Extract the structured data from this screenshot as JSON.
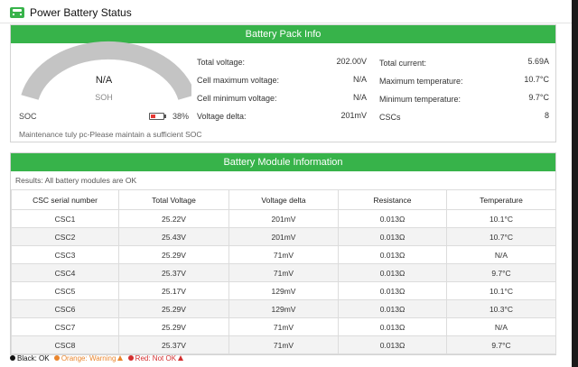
{
  "window": {
    "title": "Power Battery Status",
    "icon": "battery-icon"
  },
  "pack_info": {
    "header": "Battery Pack Info",
    "soh_value": "N/A",
    "soh_label": "SOH",
    "soc_label": "SOC",
    "soc_value": "38%",
    "soc_level": 0.38,
    "maintenance_note": "Maintenance tuly pc-Please maintain a sufficient SOC",
    "left_fields": [
      {
        "label": "Total voltage:",
        "value": "202.00V"
      },
      {
        "label": "Cell maximum voltage:",
        "value": "N/A"
      },
      {
        "label": "Cell minimum voltage:",
        "value": "N/A"
      },
      {
        "label": "Voltage delta:",
        "value": "201mV"
      }
    ],
    "right_fields": [
      {
        "label": "Total current:",
        "value": "5.69A"
      },
      {
        "label": "Maximum temperature:",
        "value": "10.7°C"
      },
      {
        "label": "Minimum temperature:",
        "value": "9.7°C"
      },
      {
        "label": "CSCs",
        "value": "8"
      }
    ]
  },
  "module_info": {
    "header": "Battery Module Information",
    "result": "Results: All battery modules are OK",
    "columns": [
      "CSC serial number",
      "Total Voltage",
      "Voltage delta",
      "Resistance",
      "Temperature"
    ],
    "rows": [
      [
        "CSC1",
        "25.22V",
        "201mV",
        "0.013Ω",
        "10.1°C"
      ],
      [
        "CSC2",
        "25.43V",
        "201mV",
        "0.013Ω",
        "10.7°C"
      ],
      [
        "CSC3",
        "25.29V",
        "71mV",
        "0.013Ω",
        "N/A"
      ],
      [
        "CSC4",
        "25.37V",
        "71mV",
        "0.013Ω",
        "9.7°C"
      ],
      [
        "CSC5",
        "25.17V",
        "129mV",
        "0.013Ω",
        "10.1°C"
      ],
      [
        "CSC6",
        "25.29V",
        "129mV",
        "0.013Ω",
        "10.3°C"
      ],
      [
        "CSC7",
        "25.29V",
        "71mV",
        "0.013Ω",
        "N/A"
      ],
      [
        "CSC8",
        "25.37V",
        "71mV",
        "0.013Ω",
        "9.7°C"
      ]
    ]
  },
  "legend": {
    "black": "Black: OK",
    "orange": "Orange: Warning",
    "red": "Red: Not OK"
  },
  "colors": {
    "accent_green": "#37b34a",
    "gauge_gray": "#c4c4c4",
    "ok_black": "#111111",
    "warning_orange": "#e9852d",
    "error_red": "#d32f2f"
  }
}
